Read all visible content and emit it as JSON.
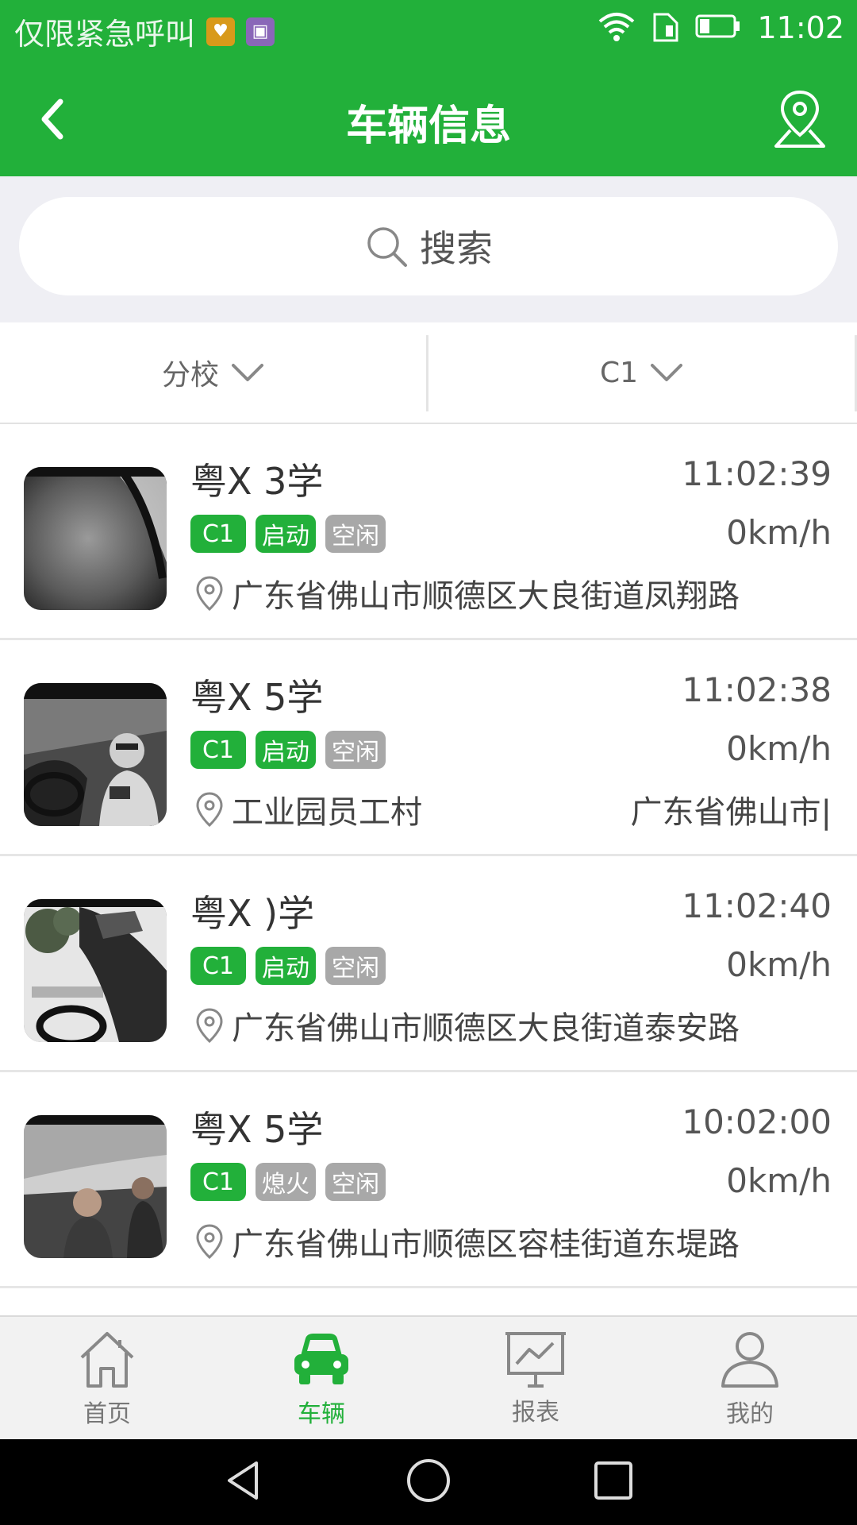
{
  "status_bar": {
    "carrier_text": "仅限紧急呼叫",
    "time": "11:02",
    "icons": [
      "app-notification-icon",
      "gallery-notification-icon",
      "wifi-icon",
      "sim-icon",
      "battery-icon"
    ]
  },
  "header": {
    "title": "车辆信息",
    "back_icon": "chevron-left-icon",
    "map_icon": "map-pin-icon"
  },
  "search": {
    "placeholder": "搜索"
  },
  "filters": {
    "branch": "分校",
    "license": "C1"
  },
  "vehicles": [
    {
      "plate": "粤X      3学",
      "time": "11:02:39",
      "license": "C1",
      "engine": "启动",
      "state": "空闲",
      "speed": "0km/h",
      "location": "广东省佛山市顺德区大良街道凤翔路",
      "location_extra": ""
    },
    {
      "plate": "粤X      5学",
      "time": "11:02:38",
      "license": "C1",
      "engine": "启动",
      "state": "空闲",
      "speed": "0km/h",
      "location": "工业园员工村",
      "location_extra": "广东省佛山市|"
    },
    {
      "plate": "粤X      )学",
      "time": "11:02:40",
      "license": "C1",
      "engine": "启动",
      "state": "空闲",
      "speed": "0km/h",
      "location": "广东省佛山市顺德区大良街道泰安路",
      "location_extra": ""
    },
    {
      "plate": "粤X      5学",
      "time": "10:02:00",
      "license": "C1",
      "engine": "熄火",
      "state": "空闲",
      "speed": "0km/h",
      "location": "广东省佛山市顺德区容桂街道东堤路",
      "location_extra": ""
    }
  ],
  "tabs": [
    {
      "label": "首页",
      "icon": "home-icon",
      "active": false
    },
    {
      "label": "车辆",
      "icon": "car-icon",
      "active": true
    },
    {
      "label": "报表",
      "icon": "chart-board-icon",
      "active": false
    },
    {
      "label": "我的",
      "icon": "user-icon",
      "active": false
    }
  ],
  "colors": {
    "brand_green": "#22b03a",
    "badge_gray": "#a8a8a8",
    "background_gray": "#efeff4"
  }
}
